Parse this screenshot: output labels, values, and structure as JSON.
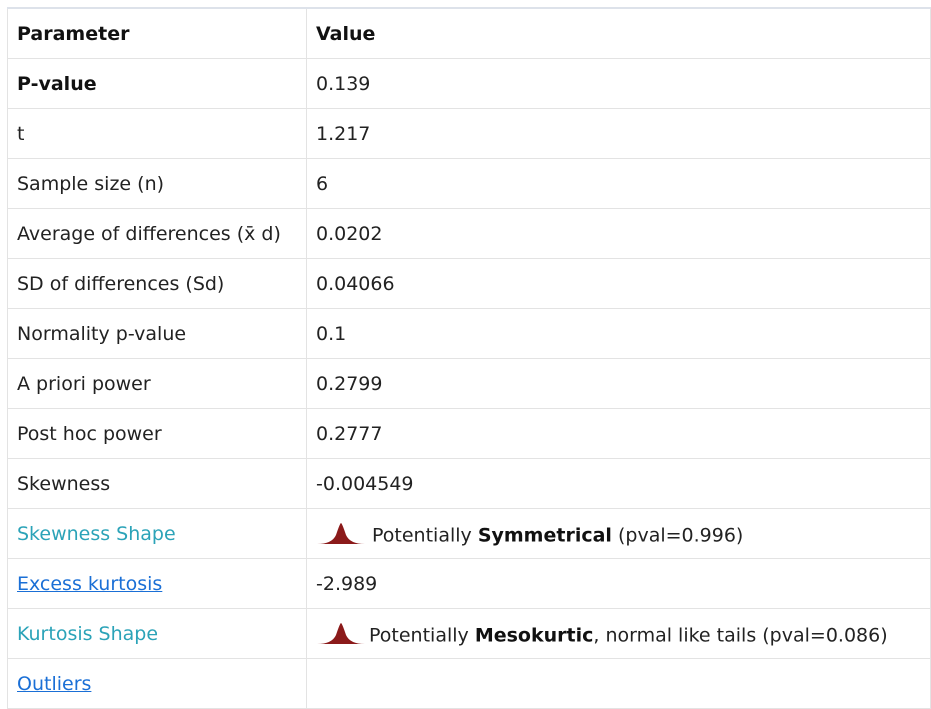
{
  "header": {
    "parameter": "Parameter",
    "value": "Value"
  },
  "rows": [
    {
      "label": "P-value",
      "value": "0.139"
    },
    {
      "label": "t",
      "value": "1.217"
    },
    {
      "label": "Sample size (n)",
      "value": "6"
    },
    {
      "label": "Average of differences (x̄ d)",
      "value": "0.0202"
    },
    {
      "label": "SD of differences (Sd)",
      "value": "0.04066"
    },
    {
      "label": "Normality p-value",
      "value": "0.1"
    },
    {
      "label": "A priori power",
      "value": "0.2799"
    },
    {
      "label": "Post hoc power",
      "value": "0.2777"
    },
    {
      "label": "Skewness",
      "value": "-0.004549"
    }
  ],
  "skewness_shape": {
    "label": "Skewness Shape",
    "prefix": "Potentially",
    "shape": "Symmetrical",
    "suffix": "(pval=0.996)"
  },
  "excess_kurtosis": {
    "label": "Excess kurtosis",
    "value": "-2.989"
  },
  "kurtosis_shape": {
    "label": "Kurtosis Shape",
    "prefix": "Potentially",
    "shape": "Mesokurtic",
    "suffix": ", normal like tails (pval=0.086)"
  },
  "outliers": {
    "label": "Outliers",
    "value": ""
  },
  "colors": {
    "teal": "#2ba3b8",
    "link": "#1a6fd6",
    "icon": "#8b1a1a",
    "border": "#e3e3e3"
  },
  "icons": {
    "shape": "bell-curve-icon"
  }
}
